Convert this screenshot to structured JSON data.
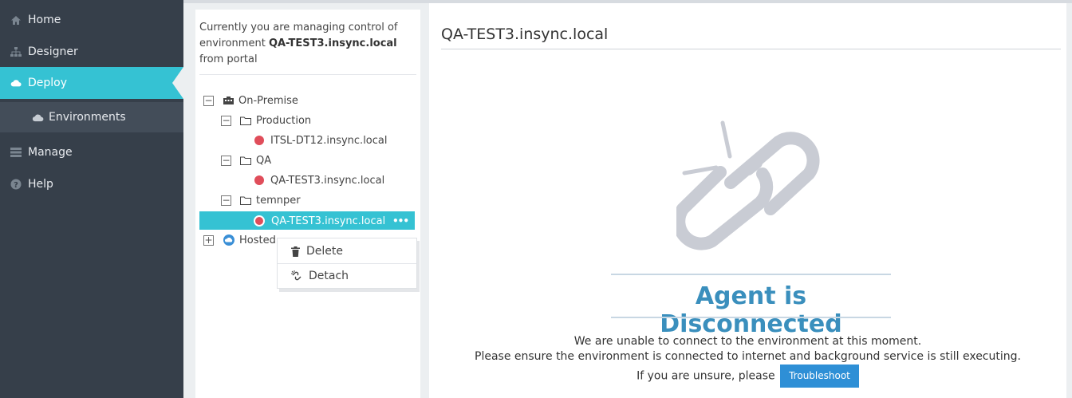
{
  "sidebar": {
    "items": [
      {
        "label": "Home",
        "icon": "home-icon"
      },
      {
        "label": "Designer",
        "icon": "sitemap-icon"
      },
      {
        "label": "Deploy",
        "icon": "cloud-icon"
      },
      {
        "label": "Manage",
        "icon": "list-icon"
      },
      {
        "label": "Help",
        "icon": "question-circle-icon"
      }
    ],
    "sub_items": [
      {
        "label": "Environments",
        "icon": "cloud-icon"
      }
    ],
    "active": "Deploy",
    "accent_color": "#35c2d3"
  },
  "tree": {
    "intro_prefix": "Currently you are managing control of environment ",
    "intro_env": "QA-TEST3.insync.local",
    "intro_suffix": " from portal",
    "nodes": {
      "on_premise": "On-Premise",
      "production": "Production",
      "production_env": "ITSL-DT12.insync.local",
      "qa": "QA",
      "qa_env": "QA-TEST3.insync.local",
      "temnper": "temnper",
      "temnper_env": "QA-TEST3.insync.local",
      "hosted": "Hosted"
    },
    "status_color": "#e04d5a"
  },
  "context_menu": {
    "delete_label": "Delete",
    "detach_label": "Detach"
  },
  "main": {
    "title": "QA-TEST3.insync.local",
    "status_heading": "Agent is Disconnected",
    "message_line1": "We are unable to connect to the environment at this moment.",
    "message_line2": "Please ensure the environment is connected to internet and background service is still executing.",
    "message_line3": "If you are unsure, please",
    "troubleshoot_label": "Troubleshoot",
    "button_color": "#2e8fd6",
    "heading_color": "#3a8fbd"
  }
}
